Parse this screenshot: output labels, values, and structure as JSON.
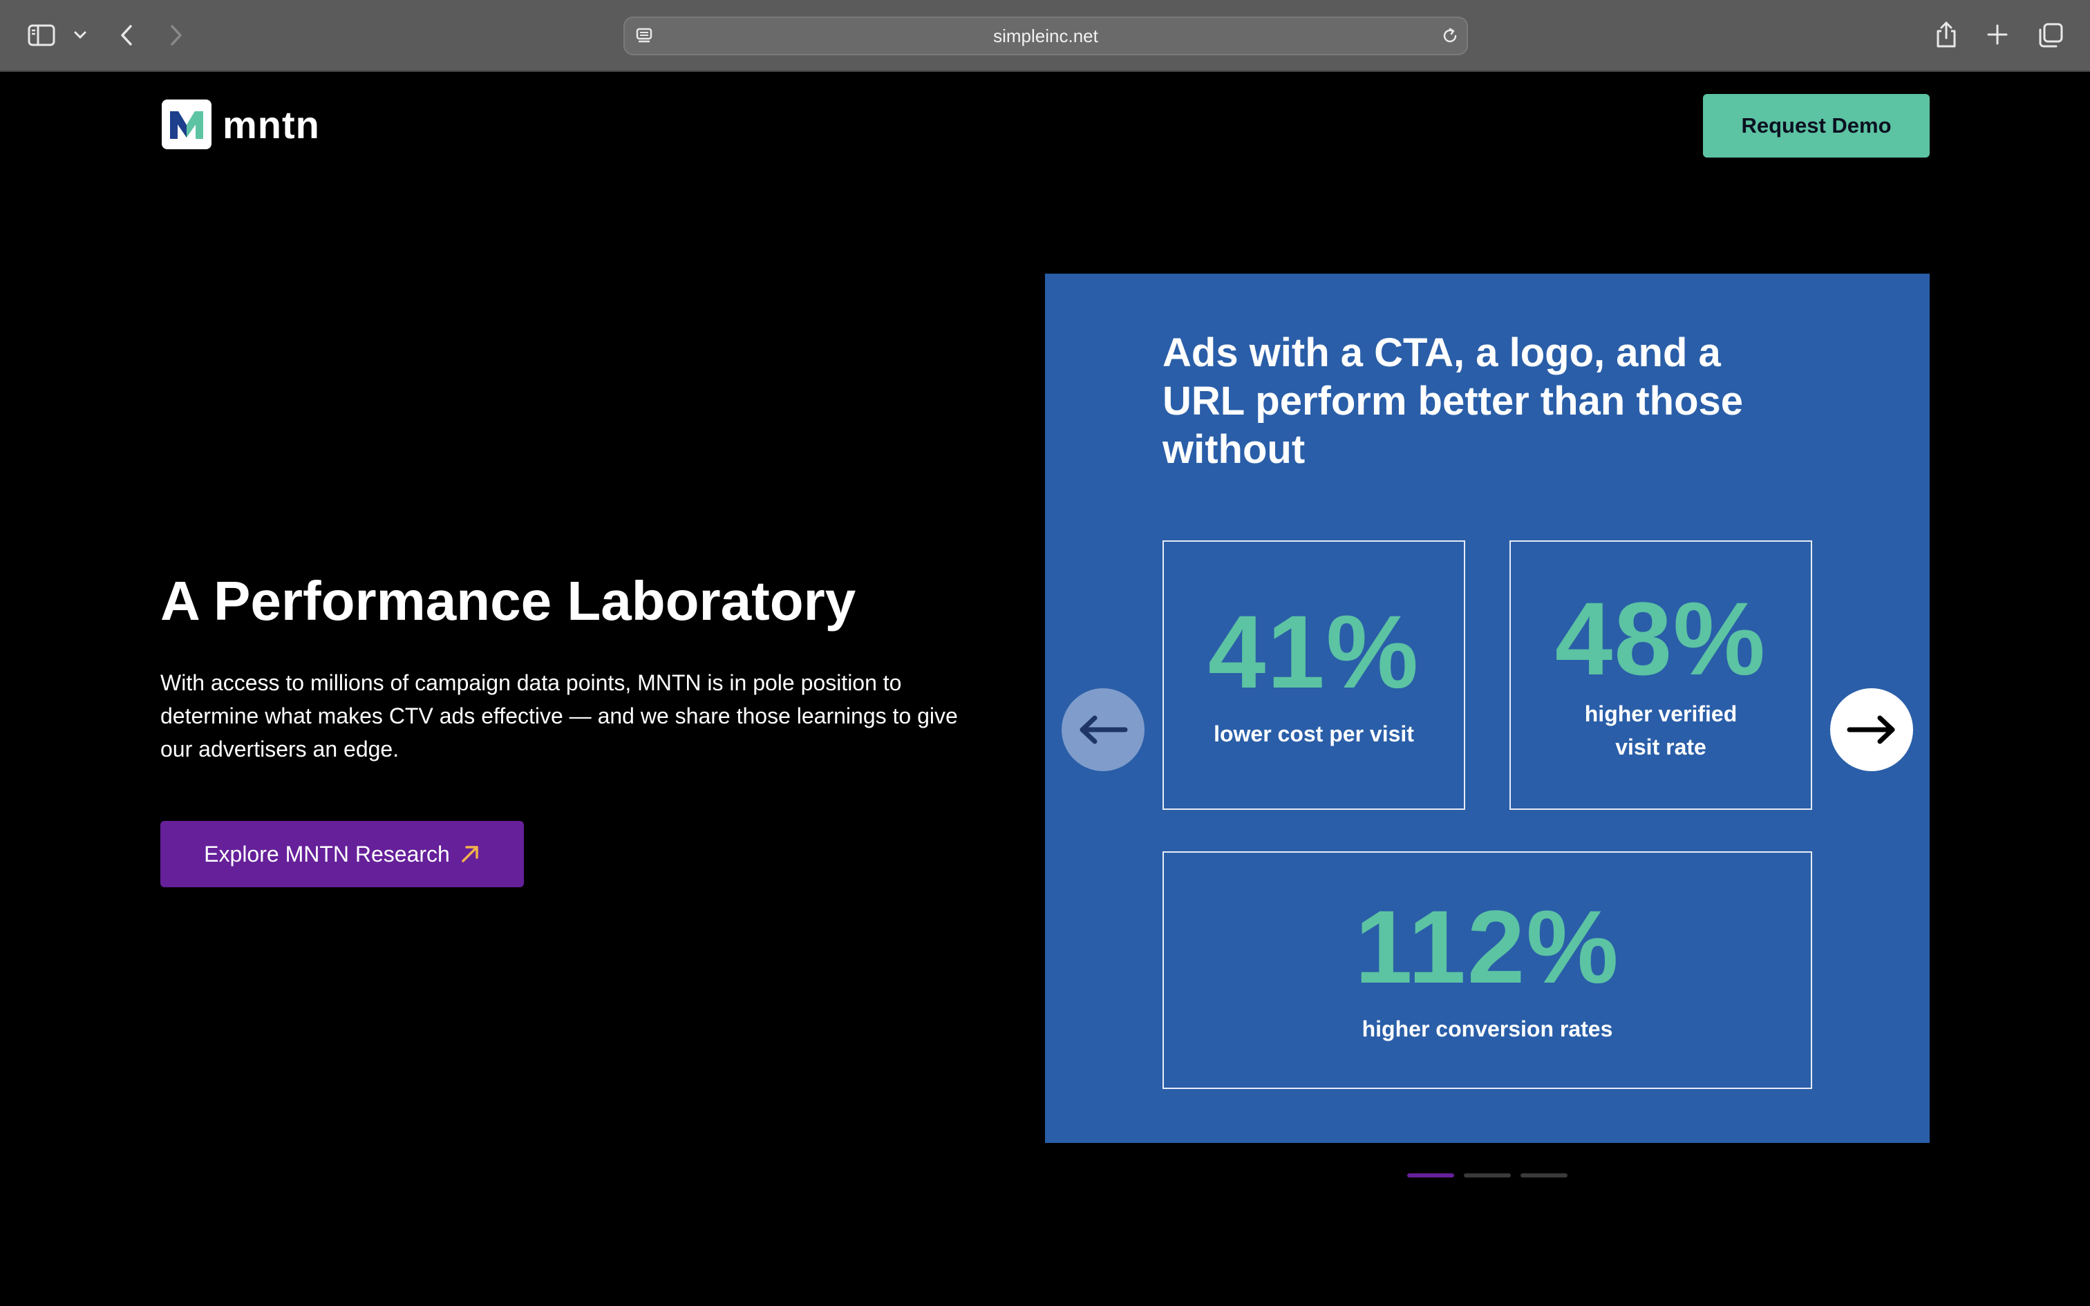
{
  "browser": {
    "url": "simpleinc.net"
  },
  "brand": {
    "name": "mntn",
    "accent": "#5cc3a3",
    "purple": "#66209a",
    "card_blue": "#2a5ea8"
  },
  "header": {
    "demo_label": "Request Demo"
  },
  "hero": {
    "title": "A Performance Laboratory",
    "description": "With access to millions of campaign data points, MNTN is in pole position to determine what makes CTV ads effective — and we share those learnings to give our advertisers an edge.",
    "cta_label": "Explore MNTN Research"
  },
  "carousel": {
    "title": "Ads with a CTA, a logo, and a URL perform better than those without",
    "stats": [
      {
        "value": "41%",
        "label": "lower cost per visit"
      },
      {
        "value": "48%",
        "label": "higher verified visit rate"
      },
      {
        "value": "112%",
        "label": "higher conversion rates"
      }
    ],
    "slide_count": 3,
    "active_slide": 1
  }
}
